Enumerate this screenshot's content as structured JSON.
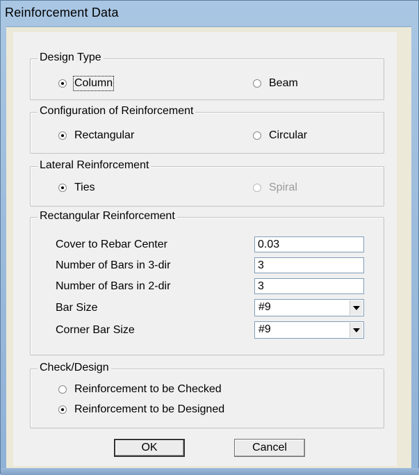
{
  "window": {
    "title": "Reinforcement Data"
  },
  "design_type": {
    "legend": "Design Type",
    "options": [
      {
        "label": "Column",
        "selected": true
      },
      {
        "label": "Beam",
        "selected": false
      }
    ]
  },
  "configuration": {
    "legend": "Configuration of Reinforcement",
    "options": [
      {
        "label": "Rectangular",
        "selected": true
      },
      {
        "label": "Circular",
        "selected": false
      }
    ]
  },
  "lateral": {
    "legend": "Lateral Reinforcement",
    "options": [
      {
        "label": "Ties",
        "selected": true
      },
      {
        "label": "Spiral",
        "selected": false,
        "disabled": true
      }
    ]
  },
  "rectangular": {
    "legend": "Rectangular Reinforcement",
    "cover_label": "Cover to Rebar Center",
    "cover_value": "0.03",
    "bars3_label": "Number of Bars in 3-dir",
    "bars3_value": "3",
    "bars2_label": "Number of Bars in 2-dir",
    "bars2_value": "3",
    "bar_size_label": "Bar Size",
    "bar_size_value": "#9",
    "corner_bar_size_label": "Corner Bar Size",
    "corner_bar_size_value": "#9"
  },
  "check_design": {
    "legend": "Check/Design",
    "options": [
      {
        "label": "Reinforcement to be Checked",
        "selected": false
      },
      {
        "label": "Reinforcement to be Designed",
        "selected": true
      }
    ]
  },
  "buttons": {
    "ok": "OK",
    "cancel": "Cancel"
  }
}
